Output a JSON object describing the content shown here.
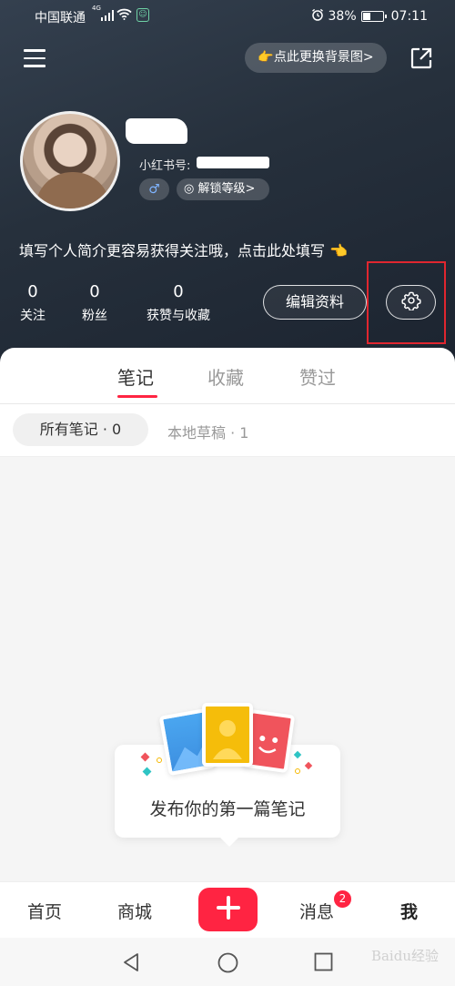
{
  "status_bar": {
    "carrier": "中国联通",
    "network": "4G",
    "battery": "38%",
    "time": "07:11"
  },
  "header": {
    "bg_change_label": "👉点此更换背景图>",
    "red_id_label": "小红书号:",
    "level_label": "解锁等级>",
    "bio": "填写个人简介更容易获得关注哦，点击此处填写 👈",
    "stats": [
      {
        "value": "0",
        "label": "关注"
      },
      {
        "value": "0",
        "label": "粉丝"
      },
      {
        "value": "0",
        "label": "获赞与收藏"
      }
    ],
    "edit_label": "编辑资料"
  },
  "tabs": [
    {
      "label": "笔记",
      "active": true
    },
    {
      "label": "收藏",
      "active": false
    },
    {
      "label": "赞过",
      "active": false
    }
  ],
  "filters": {
    "all_notes": "所有笔记 · 0",
    "drafts": "本地草稿 · 1"
  },
  "empty_state": {
    "text": "发布你的第一篇笔记"
  },
  "tabbar": {
    "items": [
      {
        "label": "首页"
      },
      {
        "label": "商城"
      },
      {
        "label": "消息",
        "badge": "2"
      },
      {
        "label": "我",
        "active": true
      }
    ]
  },
  "watermark": "Baidu经验",
  "colors": {
    "accent": "#ff2442",
    "header_bg": "#26303c",
    "highlight": "#e0262f"
  }
}
